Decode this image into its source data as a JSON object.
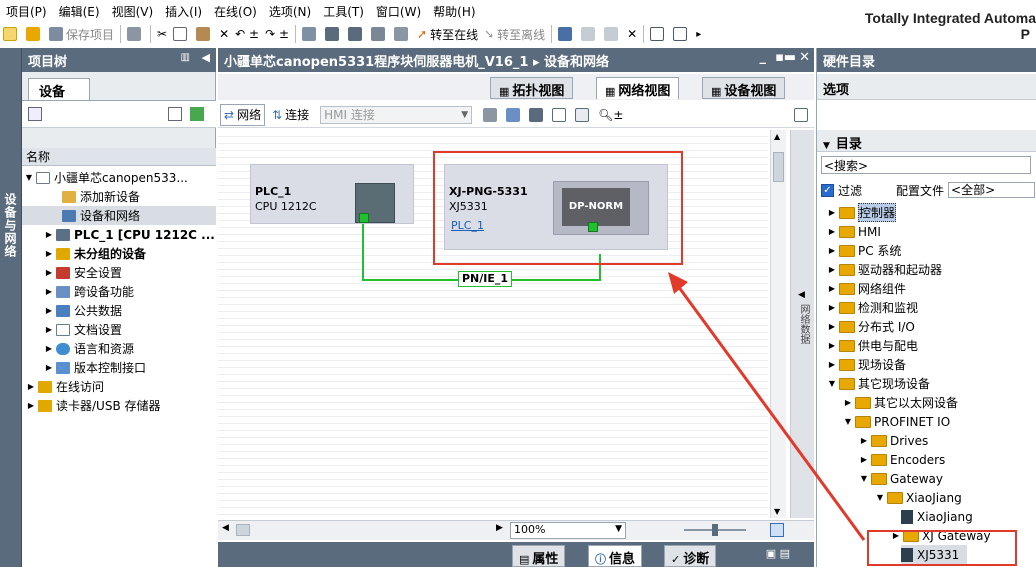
{
  "menubar": {
    "items": [
      "项目(P)",
      "编辑(E)",
      "视图(V)",
      "插入(I)",
      "在线(O)",
      "选项(N)",
      "工具(T)",
      "窗口(W)",
      "帮助(H)"
    ],
    "brand": "Totally Integrated Automa",
    "brand2": "P"
  },
  "toolbar": {
    "save_project": "保存项目",
    "go_online": "转至在线",
    "go_offline": "转至离线"
  },
  "left_vertical_tab": "设备与网络",
  "project_tree": {
    "title": "项目树",
    "tab": "设备",
    "column_header": "名称",
    "rows": [
      {
        "label": "小疆单芯canopen533...",
        "bold": false
      },
      {
        "label": "添加新设备",
        "bold": false
      },
      {
        "label": "设备和网络",
        "bold": false
      },
      {
        "label": "PLC_1 [CPU 1212C ...",
        "bold": true
      },
      {
        "label": "未分组的设备",
        "bold": true
      },
      {
        "label": "安全设置",
        "bold": false
      },
      {
        "label": "跨设备功能",
        "bold": false
      },
      {
        "label": "公共数据",
        "bold": false
      },
      {
        "label": "文档设置",
        "bold": false
      },
      {
        "label": "语言和资源",
        "bold": false
      },
      {
        "label": "版本控制接口",
        "bold": false
      },
      {
        "label": "在线访问",
        "bold": false
      },
      {
        "label": "读卡器/USB 存储器",
        "bold": false
      }
    ]
  },
  "editor": {
    "title": "小疆单芯canopen5331程序块伺服器电机_V16_1  ▸  设备和网络",
    "views": [
      "拓扑视图",
      "网络视图",
      "设备视图"
    ],
    "network_label": "网络",
    "connect_label": "连接",
    "connection_type": "HMI 连接",
    "plc": {
      "name": "PLC_1",
      "cpu": "CPU 1212C"
    },
    "device": {
      "name": "XJ-PNG-5331",
      "type": "XJ5331",
      "link": "PLC_1",
      "module": "DP-NORM"
    },
    "subnet": "PN/IE_1",
    "zoom": "100%",
    "vertical_side_tab": "网络数据"
  },
  "inspector": {
    "tabs": [
      "属性",
      "信息",
      "诊断"
    ]
  },
  "hardware_catalog": {
    "title": "硬件目录",
    "options": "选项",
    "catalog_label": "目录",
    "search_placeholder": "<搜索>",
    "filter_label": "过滤",
    "profile_label": "配置文件",
    "profile_value": "<全部>",
    "items": [
      {
        "label": "控制器",
        "level": 0,
        "state": "collapsed"
      },
      {
        "label": "HMI",
        "level": 0,
        "state": "collapsed"
      },
      {
        "label": "PC 系统",
        "level": 0,
        "state": "collapsed"
      },
      {
        "label": "驱动器和起动器",
        "level": 0,
        "state": "collapsed"
      },
      {
        "label": "网络组件",
        "level": 0,
        "state": "collapsed"
      },
      {
        "label": "检测和监视",
        "level": 0,
        "state": "collapsed"
      },
      {
        "label": "分布式 I/O",
        "level": 0,
        "state": "collapsed"
      },
      {
        "label": "供电与配电",
        "level": 0,
        "state": "collapsed"
      },
      {
        "label": "现场设备",
        "level": 0,
        "state": "collapsed"
      },
      {
        "label": "其它现场设备",
        "level": 0,
        "state": "expanded"
      },
      {
        "label": "其它以太网设备",
        "level": 1,
        "state": "collapsed"
      },
      {
        "label": "PROFINET IO",
        "level": 1,
        "state": "expanded"
      },
      {
        "label": "Drives",
        "level": 2,
        "state": "collapsed"
      },
      {
        "label": "Encoders",
        "level": 2,
        "state": "collapsed"
      },
      {
        "label": "Gateway",
        "level": 2,
        "state": "expanded"
      },
      {
        "label": "XiaoJiang",
        "level": 3,
        "state": "expanded"
      },
      {
        "label": "XiaoJiang",
        "level": 4,
        "state": "leaf"
      },
      {
        "label": "XJ Gateway",
        "level": 4,
        "state": "collapsed"
      },
      {
        "label": "XJ5331",
        "level": 4,
        "state": "leaf"
      }
    ]
  },
  "colors": {
    "panel_header": "#5a6b7d",
    "highlight": "#e23a2a",
    "link": "#1a5fb4",
    "connection": "#22c030"
  }
}
